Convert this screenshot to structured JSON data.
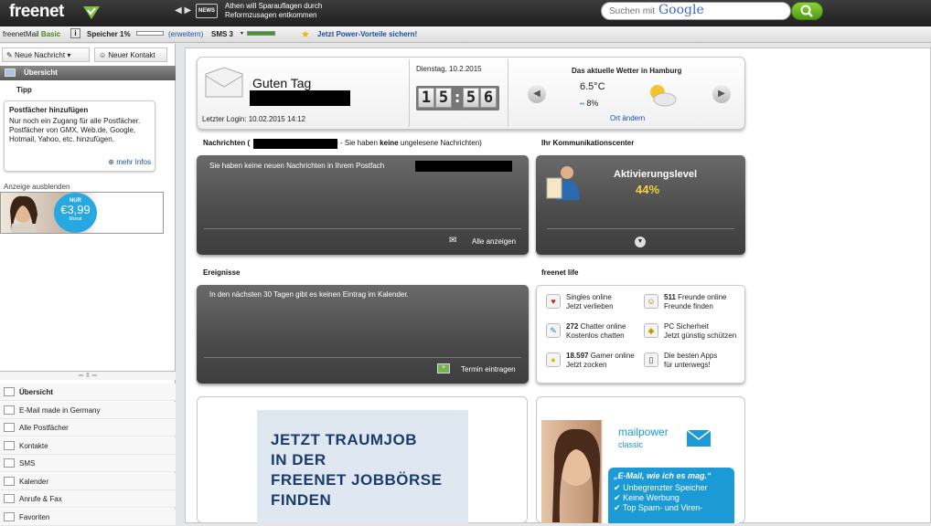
{
  "header": {
    "logo": "freenet",
    "news_badge": "NEWS",
    "news_text": "Athen will Sparauflagen durch Reformzusagen entkommen",
    "search_placeholder": "Suchen mit",
    "search_brand": "Google"
  },
  "statusbar": {
    "account": "freenetMail",
    "account_plan": "Basic",
    "info_icon": "i",
    "storage_label": "Speicher 1%",
    "storage_link": "(erweitern)",
    "sms_label": "SMS 3",
    "promo": "Jetzt Power-Vorteile sichern!"
  },
  "sidebar": {
    "new_message": "Neue Nachricht",
    "new_contact": "Neuer Kontakt",
    "overview_header": "Übersicht",
    "tip_label": "Tipp",
    "tip_title": "Postfächer hinzufügen",
    "tip_body": "Nur noch ein Zugang für alle Postfächer. Postfächer von GMX, Web.de, Google, Hotmail, Yahoo, etc. hinzufügen.",
    "tip_more": "mehr Infos",
    "ad_hide": "Anzeige ausblenden",
    "ad_price_top": "NUR",
    "ad_price": "€3,99",
    "ad_price_sub": "Monat",
    "nav": [
      {
        "label": "Übersicht",
        "icon": "overview-icon"
      },
      {
        "label": "E-Mail made in Germany",
        "icon": "germany-flag-icon"
      },
      {
        "label": "Alle Postfächer",
        "icon": "mail-icon"
      },
      {
        "label": "Kontakte",
        "icon": "contacts-icon"
      },
      {
        "label": "SMS",
        "icon": "phone-icon"
      },
      {
        "label": "Kalender",
        "icon": "calendar-icon"
      },
      {
        "label": "Anrufe & Fax",
        "icon": "fax-icon"
      },
      {
        "label": "Favoriten",
        "icon": "star-icon"
      }
    ]
  },
  "greeting": {
    "title": "Guten Tag",
    "last_login": "Letzter Login: 10.02.2015 14:12",
    "date": "Dienstag, 10.2.2015",
    "time_digits": [
      "1",
      "5",
      ":",
      "5",
      "6"
    ],
    "weather_title": "Das aktuelle Wetter in Hamburg",
    "temp": "6.5°C",
    "rain": "8%",
    "change_location": "Ort ändern"
  },
  "messages": {
    "title_prefix": "Nachrichten (",
    "title_suffix": ") - Sie haben",
    "title_bold": "keine",
    "title_end": "ungelesene Nachrichten)",
    "body": "Sie haben keine neuen Nachrichten in Ihrem Postfach",
    "show_all": "Alle anzeigen"
  },
  "comm": {
    "title": "Ihr Kommunikationscenter",
    "level_label": "Aktivierungslevel",
    "level_value": "44%"
  },
  "events": {
    "title": "Ereignisse",
    "body": "In den nächsten 30 Tagen gibt es keinen Eintrag im Kalender.",
    "add_entry": "Termin eintragen"
  },
  "life": {
    "title": "freenet life",
    "items": [
      {
        "bold": "",
        "line1": "Singles online",
        "line2": "Jetzt verlieben",
        "icon": "heart-icon",
        "glyph": "♥"
      },
      {
        "bold": "511",
        "line1": " Freunde online",
        "line2": "Freunde finden",
        "icon": "friends-icon",
        "glyph": "☺"
      },
      {
        "bold": "272",
        "line1": " Chatter online",
        "line2": "Kostenlos chatten",
        "icon": "chat-icon",
        "glyph": "✎"
      },
      {
        "bold": "",
        "line1": "PC Sicherheit",
        "line2": "Jetzt günstig schützen",
        "icon": "shield-icon",
        "glyph": "◆"
      },
      {
        "bold": "18.597",
        "line1": " Gamer online",
        "line2": "Jetzt zocken",
        "icon": "game-icon",
        "glyph": "●"
      },
      {
        "bold": "",
        "line1": "Die besten Apps",
        "line2": "für unterwegs!",
        "icon": "smartphone-icon",
        "glyph": "▯"
      }
    ]
  },
  "job_ad": {
    "lines": [
      "JETZT TRAUMJOB",
      "IN DER",
      "FREENET JOBBÖRSE",
      "FINDEN"
    ]
  },
  "mailpower_ad": {
    "brand": "mailpower",
    "sub": "classic",
    "slogan": "„E-Mail, wie ich es mag.“",
    "bullets": [
      "Unbegrenzter Speicher",
      "Keine Werbung",
      "Top Spam- und Viren-"
    ]
  }
}
